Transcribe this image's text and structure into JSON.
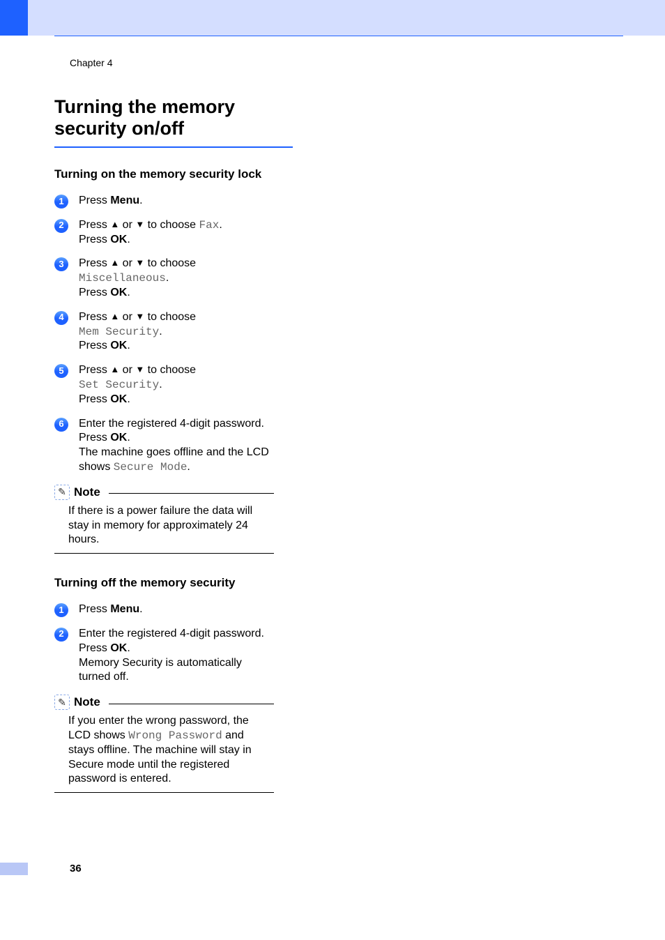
{
  "chapter": "Chapter 4",
  "page_number": "36",
  "heading": "Turning the memory security on/off",
  "section_on": {
    "title": "Turning on the memory security lock",
    "steps": [
      {
        "num": "1",
        "l1a": "Press ",
        "bold1": "Menu",
        "l1b": "."
      },
      {
        "num": "2",
        "l1a": "Press ",
        "arrows": true,
        "l1b": " to choose ",
        "mono1": "Fax",
        "l1c": ".",
        "l2a": "Press ",
        "bold2": "OK",
        "l2b": "."
      },
      {
        "num": "3",
        "l1a": "Press ",
        "arrows": true,
        "l1b": " to choose ",
        "l2mono": "Miscellaneous",
        "l2c": ".",
        "l3a": "Press ",
        "bold3": "OK",
        "l3b": "."
      },
      {
        "num": "4",
        "l1a": "Press ",
        "arrows": true,
        "l1b": " to choose ",
        "l2mono": "Mem Security",
        "l2c": ".",
        "l3a": "Press ",
        "bold3": "OK",
        "l3b": "."
      },
      {
        "num": "5",
        "l1a": "Press ",
        "arrows": true,
        "l1b": " to choose ",
        "l2mono": "Set Security",
        "l2c": ".",
        "l3a": "Press ",
        "bold3": "OK",
        "l3b": "."
      },
      {
        "num": "6",
        "l1a": "Enter the registered 4-digit password.",
        "l2a": "Press ",
        "bold2": "OK",
        "l2b": ".",
        "l3a": "The machine goes offline and the LCD shows ",
        "mono3": "Secure Mode",
        "l3b": "."
      }
    ],
    "note_title": "Note",
    "note_text": "If there is a power failure the data will stay in memory for approximately 24 hours."
  },
  "section_off": {
    "title": "Turning off the memory security",
    "steps": [
      {
        "num": "1",
        "l1a": "Press ",
        "bold1": "Menu",
        "l1b": "."
      },
      {
        "num": "2",
        "l1a": "Enter the registered 4-digit password.",
        "l2a": "Press ",
        "bold2": "OK",
        "l2b": ".",
        "l3a": "Memory Security is automatically turned off."
      }
    ],
    "note_title": "Note",
    "note_text_a": "If you enter the wrong password, the LCD shows ",
    "note_mono": "Wrong Password",
    "note_text_b": " and stays offline. The machine will stay in Secure mode until the registered password is entered."
  },
  "glyphs": {
    "up": "▲",
    "down": "▼",
    "or": " or ",
    "pencil": "✎"
  }
}
